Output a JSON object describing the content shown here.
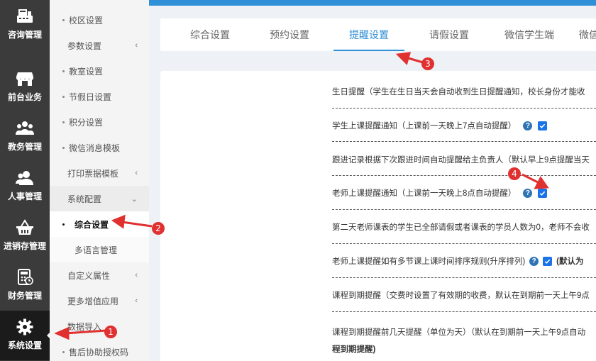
{
  "rail": [
    {
      "label": "咨询管理",
      "icon": "register-icon"
    },
    {
      "label": "前台业务",
      "icon": "storefront-icon"
    },
    {
      "label": "教务管理",
      "icon": "users-group-icon"
    },
    {
      "label": "人事管理",
      "icon": "person-icon"
    },
    {
      "label": "进销存管理",
      "icon": "basket-icon"
    },
    {
      "label": "财务管理",
      "icon": "calculator-icon"
    },
    {
      "label": "系统设置",
      "icon": "gear-icon",
      "active": true
    }
  ],
  "submenu": [
    {
      "label": "校区设置"
    },
    {
      "label": "参数设置",
      "chevron": "‹"
    },
    {
      "label": "教室设置"
    },
    {
      "label": "节假日设置"
    },
    {
      "label": "积分设置"
    },
    {
      "label": "微信消息模板"
    },
    {
      "label": "打印票据模板",
      "chevron": "‹"
    },
    {
      "label": "系统配置",
      "chevron": "⌄"
    },
    {
      "label": "综合设置"
    },
    {
      "label": "多语言管理"
    },
    {
      "label": "自定义属性",
      "chevron": "‹"
    },
    {
      "label": "更多增值应用",
      "chevron": "‹"
    },
    {
      "label": "数据导入"
    },
    {
      "label": "售后协助授权码"
    }
  ],
  "tabs": [
    {
      "label": "综合设置"
    },
    {
      "label": "预约设置"
    },
    {
      "label": "提醒设置",
      "active": true
    },
    {
      "label": "请假设置"
    },
    {
      "label": "微信学生端"
    },
    {
      "label": "微信"
    }
  ],
  "settings": [
    {
      "text": "生日提醒（学生在生日当天会自动收到生日提醒通知，校长身份才能收"
    },
    {
      "text": "学生上课提醒通知（上课前一天晚上7点自动提醒）",
      "help": "?",
      "checked": true
    },
    {
      "text": "跟进记录根据下次跟进时间自动提醒给主负责人（默认早上9点提醒当天"
    },
    {
      "text": "老师上课提醒通知（上课前一天晚上8点自动提醒）",
      "help": "?",
      "checked": true
    },
    {
      "text": "第二天老师课表的学生已全部请假或者课表的学员人数为0，老师不会收"
    },
    {
      "text": "老师上课提醒如有多节课上课时间排序规则(升序排列)",
      "help": "?",
      "checked": true,
      "extra": "(默认为"
    },
    {
      "text": "课程到期提醒（交费时设置了有效期的收费，默认在到期前一天上午9点"
    },
    {
      "text": "课程到期提醒前几天提醒（单位为天）（默认在到期前一天上午9点自动",
      "line2": "程到期提醒)"
    }
  ],
  "annotations": [
    "1",
    "2",
    "3",
    "4"
  ],
  "colors": {
    "accent": "#2f8fd7",
    "rail": "#3b3b3b",
    "marker": "#e0302f"
  }
}
